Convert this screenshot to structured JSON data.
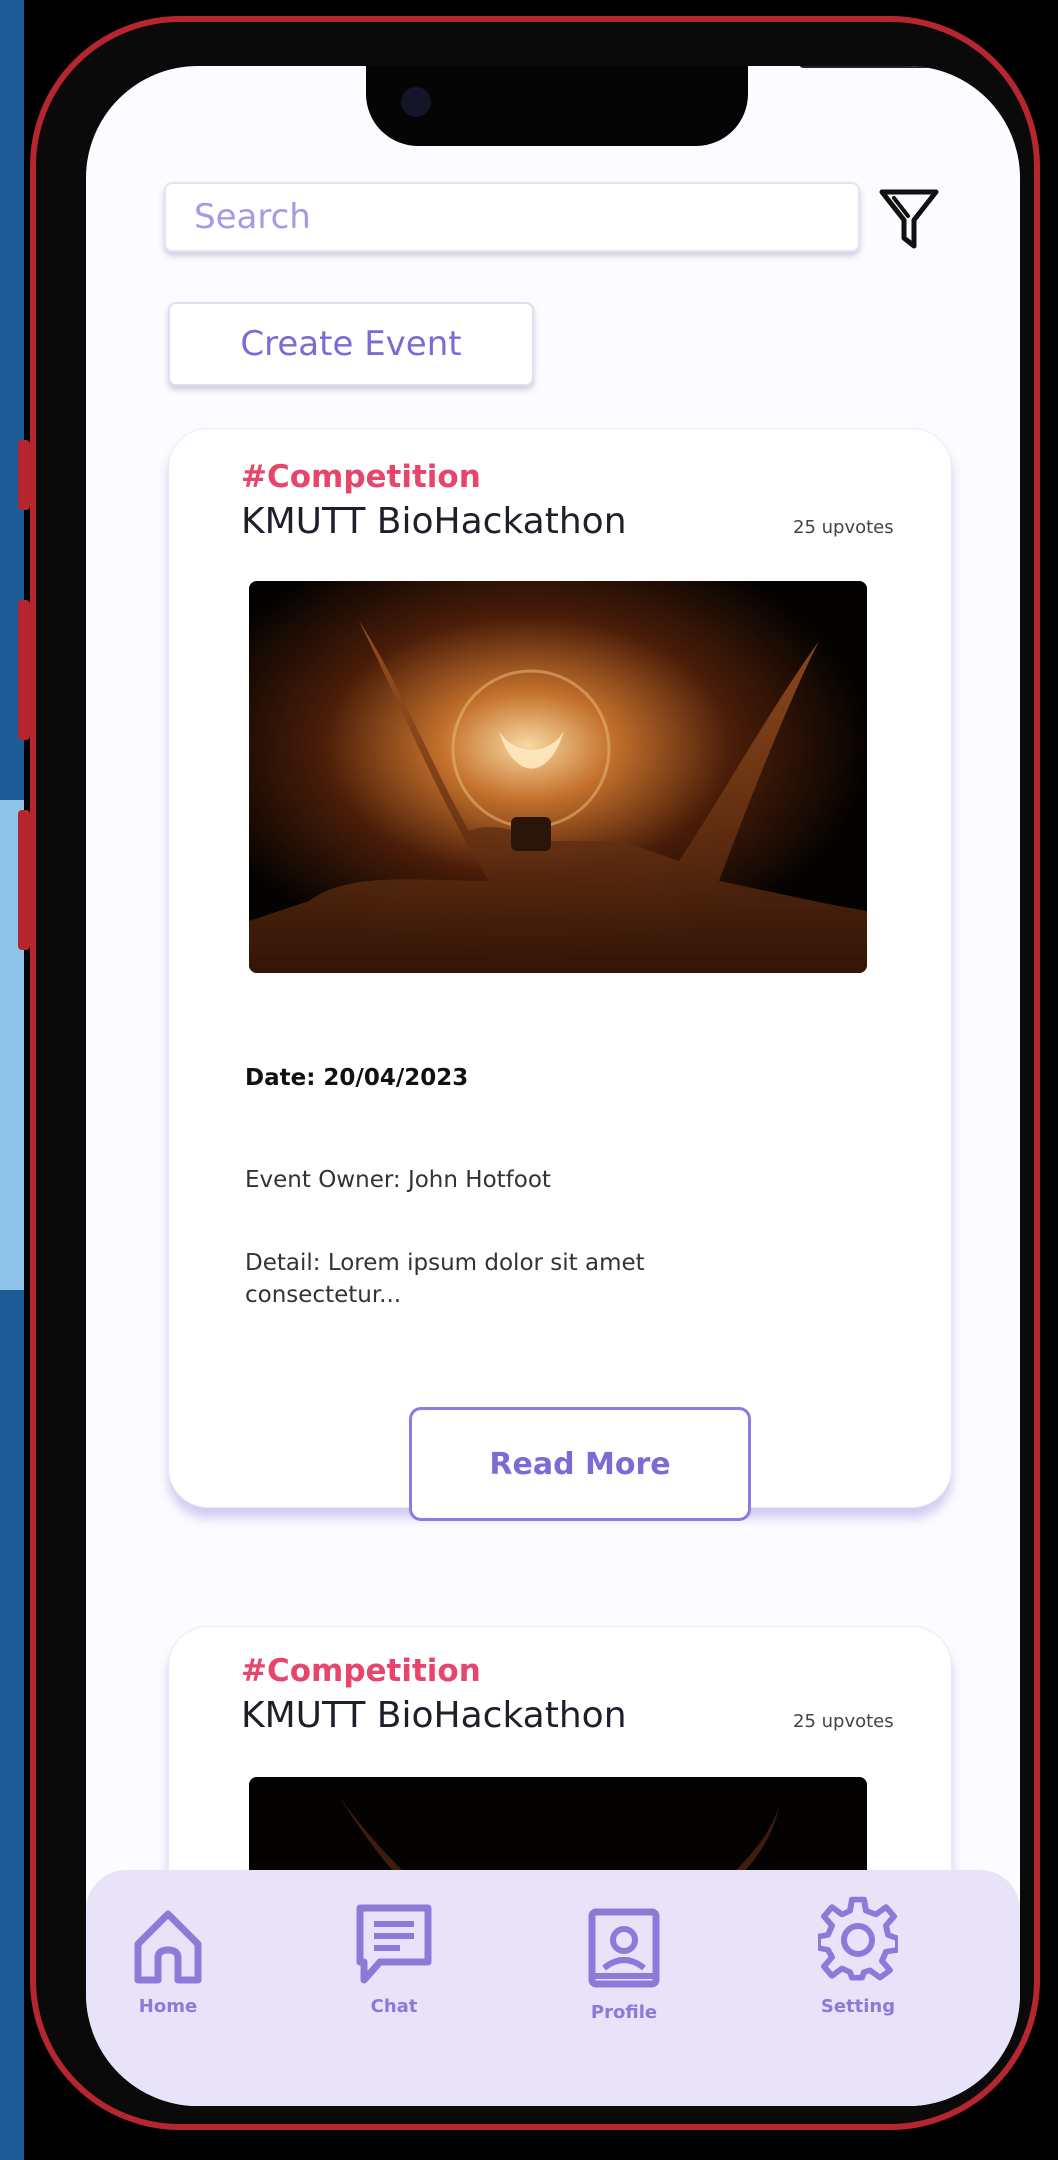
{
  "search": {
    "placeholder": "Search"
  },
  "toolbar": {
    "create_event_label": "Create Event"
  },
  "events": [
    {
      "tag": "#Competition",
      "title": "KMUTT BioHackathon",
      "upvotes": "25 upvotes",
      "date": "Date: 20/04/2023",
      "owner": "Event Owner: John Hotfoot",
      "detail": "Detail: Lorem ipsum dolor sit amet consectetur...",
      "read_more_label": "Read More"
    },
    {
      "tag": "#Competition",
      "title": "KMUTT BioHackathon",
      "upvotes": "25 upvotes"
    }
  ],
  "bottom_nav": [
    {
      "label": "Home",
      "icon": "home-icon"
    },
    {
      "label": "Chat",
      "icon": "chat-icon"
    },
    {
      "label": "Profile",
      "icon": "profile-icon"
    },
    {
      "label": "Setting",
      "icon": "gear-icon"
    }
  ],
  "colors": {
    "accent": "#7c6bd2",
    "tag": "#e8456d",
    "nav_bg": "#e9e3fa",
    "frame": "#b5262f"
  }
}
